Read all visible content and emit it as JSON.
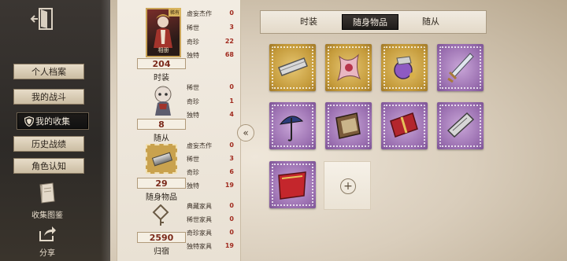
{
  "sidebar": {
    "items": [
      {
        "label": "个人档案",
        "active": false
      },
      {
        "label": "我的战斗",
        "active": false
      },
      {
        "label": "我的收集",
        "active": true
      },
      {
        "label": "历史战绩",
        "active": false
      },
      {
        "label": "角色认知",
        "active": false
      }
    ],
    "tools": [
      {
        "label": "收集图鉴",
        "icon": "book-icon"
      },
      {
        "label": "分享",
        "icon": "share-icon"
      }
    ]
  },
  "stats": {
    "costume": {
      "portrait_tag": "稀有",
      "portrait_name": "相册",
      "count": "204",
      "label": "时装",
      "rows": [
        {
          "k": "虚妄杰作",
          "v": "0"
        },
        {
          "k": "稀世",
          "v": "3"
        },
        {
          "k": "奇珍",
          "v": "22"
        },
        {
          "k": "独特",
          "v": "68"
        }
      ]
    },
    "follower": {
      "count": "8",
      "label": "随从",
      "rows": [
        {
          "k": "稀世",
          "v": "0"
        },
        {
          "k": "奇珍",
          "v": "1"
        },
        {
          "k": "独特",
          "v": "4"
        }
      ]
    },
    "accessory": {
      "count": "29",
      "label": "随身物品",
      "rows": [
        {
          "k": "虚妄杰作",
          "v": "0"
        },
        {
          "k": "稀世",
          "v": "3"
        },
        {
          "k": "奇珍",
          "v": "6"
        },
        {
          "k": "独特",
          "v": "19"
        }
      ]
    },
    "home": {
      "count": "2590",
      "label": "归宿",
      "rows": [
        {
          "k": "典藏家具",
          "v": "0"
        },
        {
          "k": "稀世家具",
          "v": "0"
        },
        {
          "k": "奇珍家具",
          "v": "0"
        },
        {
          "k": "独特家具",
          "v": "19"
        }
      ]
    }
  },
  "collapse_button": "«",
  "tabs": [
    {
      "label": "时装",
      "active": false
    },
    {
      "label": "随身物品",
      "active": true
    },
    {
      "label": "随从",
      "active": false
    }
  ],
  "grid": {
    "items": [
      {
        "rarity": "gold",
        "icon": "silver-bracelet-icon"
      },
      {
        "rarity": "gold",
        "icon": "pink-ribbon-ornament-icon"
      },
      {
        "rarity": "gold",
        "icon": "mechanical-ornament-icon"
      },
      {
        "rarity": "purple",
        "icon": "dagger-icon"
      },
      {
        "rarity": "purple",
        "icon": "umbrella-icon"
      },
      {
        "rarity": "purple",
        "icon": "book-icon"
      },
      {
        "rarity": "purple",
        "icon": "red-gift-box-icon"
      },
      {
        "rarity": "purple",
        "icon": "silver-case-icon"
      },
      {
        "rarity": "purple",
        "icon": "red-banner-icon"
      }
    ],
    "add_symbol": "+"
  },
  "colors": {
    "gold_stamp": "#c49a3a",
    "purple_stamp": "#9a6fb0",
    "count_text": "#7b2a1b",
    "stat_value": "#a12b1f"
  }
}
